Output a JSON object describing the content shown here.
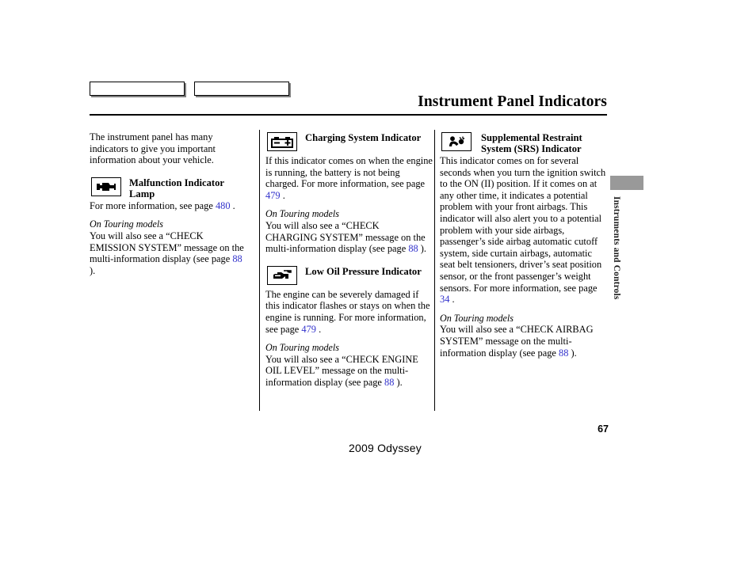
{
  "document": {
    "title": "Instrument Panel Indicators",
    "page_number": "67",
    "model_footer": "2009  Odyssey",
    "sidebar_tab_label": "Instruments and Controls"
  },
  "nav": {
    "box1_label": "",
    "box2_label": ""
  },
  "intro": {
    "text": "The instrument panel has many indicators to give you important information about your vehicle."
  },
  "touring_heading": "On Touring models",
  "indicators": [
    {
      "id": "malfunction-indicator-lamp",
      "icon": "engine-icon",
      "title": "Malfunction Indicator Lamp",
      "body_pre": "For more information, see page ",
      "body_ref": "480",
      "body_post": " .",
      "touring_pre": "You will also see a “CHECK EMISSION SYSTEM” message on the multi-information display (see page ",
      "touring_ref": "88",
      "touring_post": " )."
    },
    {
      "id": "charging-system-indicator",
      "icon": "battery-icon",
      "title": "Charging System Indicator",
      "body_pre": "If this indicator comes on when the engine is running, the battery is not being charged. For more information, see page ",
      "body_ref": "479",
      "body_post": " .",
      "touring_pre": "You will also see a “CHECK CHARGING SYSTEM” message on the multi-information display (see page ",
      "touring_ref": "88",
      "touring_post": " )."
    },
    {
      "id": "low-oil-pressure-indicator",
      "icon": "oil-can-icon",
      "title": "Low Oil Pressure Indicator",
      "body_pre": "The engine can be severely damaged if this indicator flashes or stays on when the engine is running. For more information, see page ",
      "body_ref": "479",
      "body_post": " .",
      "touring_pre": "You will also see a “CHECK ENGINE OIL LEVEL” message on the multi-information display (see page ",
      "touring_ref": "88",
      "touring_post": " )."
    },
    {
      "id": "srs-indicator",
      "icon": "airbag-icon",
      "title": "Supplemental Restraint System (SRS) Indicator",
      "body_pre": "This indicator comes on for several seconds when you turn the ignition switch to the ON (II) position. If it comes on at any other time, it indicates a potential problem with your front airbags. This indicator will also alert you to a potential problem with your side airbags, passenger’s side airbag automatic cutoff system, side curtain airbags, automatic seat belt tensioners, driver’s seat position sensor, or the front passenger’s weight sensors. For more information, see page ",
      "body_ref": "34",
      "body_post": " .",
      "touring_pre": "You will also see a “CHECK AIRBAG SYSTEM” message on the multi-information display (see page ",
      "touring_ref": "88",
      "touring_post": " )."
    }
  ],
  "colors": {
    "reference_link": "#3333cc",
    "tab_block": "#999999",
    "text": "#000000"
  }
}
